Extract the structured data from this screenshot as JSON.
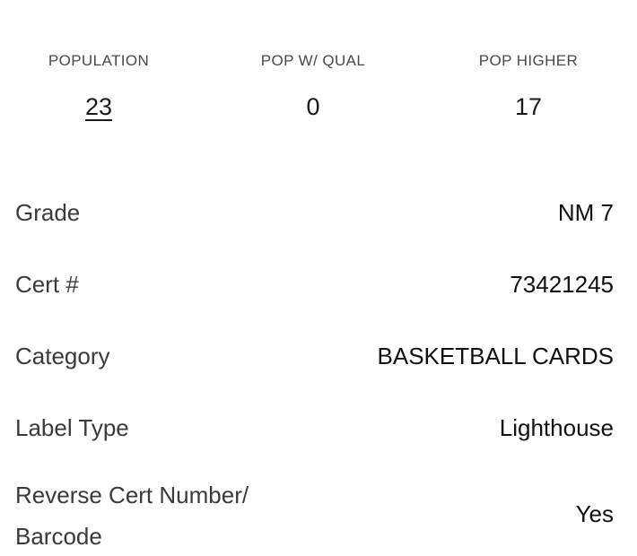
{
  "population_stats": [
    {
      "label": "POPULATION",
      "value": "23",
      "is_link": true
    },
    {
      "label": "POP W/ QUAL",
      "value": "0",
      "is_link": false
    },
    {
      "label": "POP HIGHER",
      "value": "17",
      "is_link": false
    }
  ],
  "details": {
    "grade": {
      "label": "Grade",
      "value": "NM 7"
    },
    "cert": {
      "label": "Cert #",
      "value": "73421245"
    },
    "category": {
      "label": "Category",
      "value": "BASKETBALL CARDS"
    },
    "label_type": {
      "label": "Label Type",
      "value": "Lighthouse"
    },
    "reverse_cert": {
      "label_line1": "Reverse Cert Number/",
      "label_line2": "Barcode",
      "value": "Yes"
    }
  },
  "colors": {
    "background": "#ffffff",
    "text_primary": "#111111",
    "text_label": "#3a3a3a",
    "text_muted": "#4a4a4a"
  }
}
